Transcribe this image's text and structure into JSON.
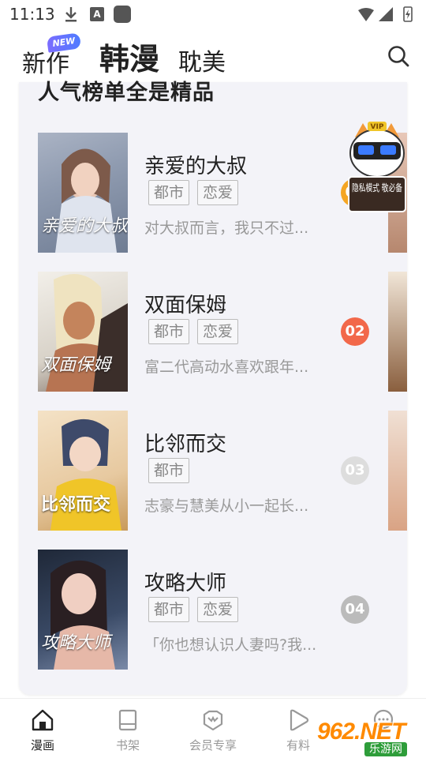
{
  "status_bar": {
    "time": "11:13",
    "notif_letter": "A"
  },
  "header": {
    "tabs": [
      {
        "label": "新作",
        "badge": "NEW"
      },
      {
        "label": "韩漫",
        "active": true
      },
      {
        "label": "耽美"
      }
    ]
  },
  "section": {
    "title": "人气榜单全是精品",
    "items": [
      {
        "title": "亲爱的大叔",
        "tags": [
          "都市",
          "恋爱"
        ],
        "desc": "对大叔而言，我只不过...",
        "rank": "01",
        "cover_text": "亲爱的大叔"
      },
      {
        "title": "双面保姆",
        "tags": [
          "都市",
          "恋爱"
        ],
        "desc": "富二代高动水喜欢跟年...",
        "rank": "02",
        "cover_text": "双面保姆"
      },
      {
        "title": "比邻而交",
        "tags": [
          "都市"
        ],
        "desc": "志豪与慧美从小一起长...",
        "rank": "03",
        "cover_text": "比邻而交"
      },
      {
        "title": "攻略大师",
        "tags": [
          "都市",
          "恋爱"
        ],
        "desc": "「你也想认识人妻吗?我...",
        "rank": "04",
        "cover_text": "攻略大师"
      }
    ]
  },
  "mascot": {
    "badge": "VIP",
    "text": "隐私模式 敬必备"
  },
  "bottom_nav": {
    "items": [
      {
        "label": "漫画",
        "icon": "home-icon",
        "active": true
      },
      {
        "label": "书架",
        "icon": "book-icon"
      },
      {
        "label": "会员专享",
        "icon": "crown-icon"
      },
      {
        "label": "有料",
        "icon": "play-icon"
      },
      {
        "label": "",
        "icon": "chat-icon"
      }
    ]
  },
  "watermark": {
    "text": "962.NET",
    "sub": "乐游网"
  },
  "colors": {
    "rank1": "#f5a623",
    "rank2": "#f2684a",
    "rank3": "#dddddd",
    "rank4": "#bbbbbb"
  }
}
